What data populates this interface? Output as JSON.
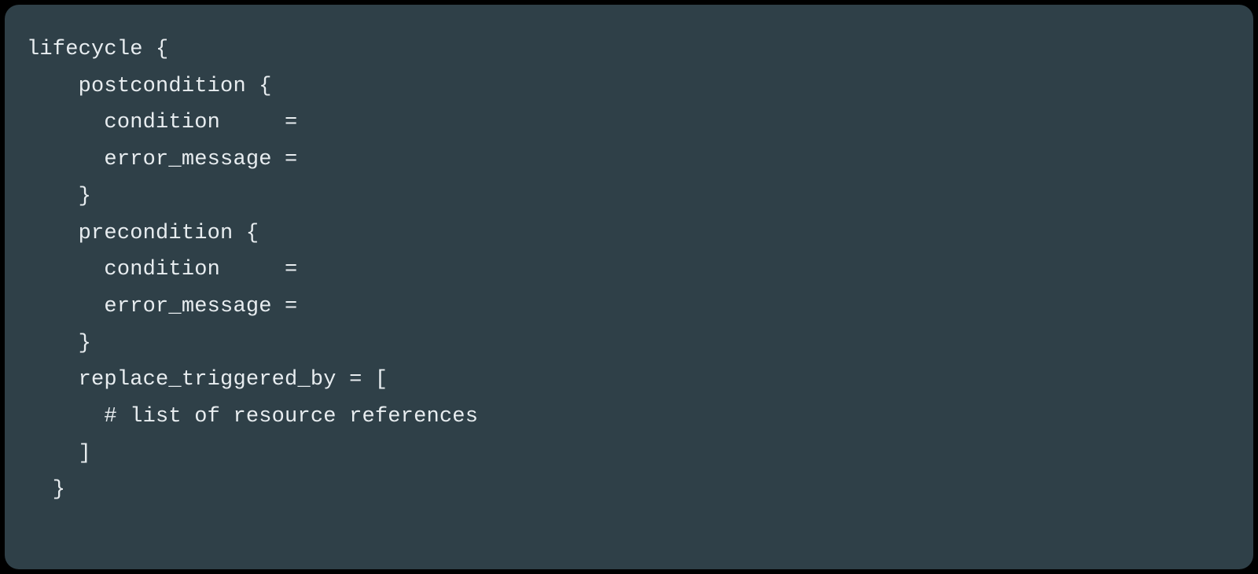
{
  "code": {
    "line1": "lifecycle {",
    "line2": "    postcondition {",
    "line3": "      condition     =",
    "line4": "      error_message =",
    "line5": "    }",
    "line6": "    precondition {",
    "line7": "      condition     =",
    "line8": "      error_message =",
    "line9": "    }",
    "line10": "    replace_triggered_by = [",
    "line11": "      # list of resource references",
    "line12": "    ]",
    "line13": "  }"
  }
}
